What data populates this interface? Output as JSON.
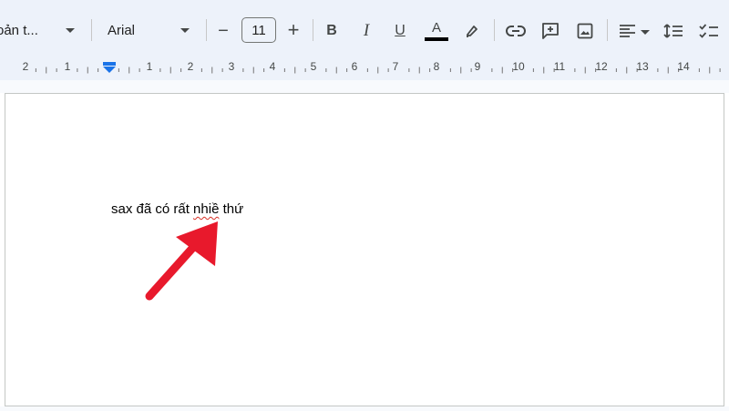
{
  "toolbar": {
    "style_dropdown": "oản t...",
    "font_family": "Arial",
    "font_size": "11",
    "decrease_font_label": "−",
    "increase_font_label": "+",
    "bold_label": "B",
    "italic_label": "I",
    "underline_label": "U",
    "text_color_label": "A",
    "text_color": "#000000"
  },
  "icons": {
    "style": "caret-down-icon",
    "highlight": "marker-pen-icon",
    "link": "link-icon",
    "comment": "add-comment-icon",
    "image": "image-icon",
    "align": "align-left-icon",
    "line_spacing": "line-spacing-icon",
    "checklist": "checklist-icon"
  },
  "ruler": {
    "labels": [
      "2",
      "1",
      "1",
      "2",
      "3",
      "4",
      "5",
      "6",
      "7",
      "8",
      "9",
      "10",
      "11",
      "12",
      "13",
      "14"
    ]
  },
  "document": {
    "text_before": "sax đã có rất ",
    "misspelled_word": "nhiề",
    "text_after": " thứ"
  },
  "colors": {
    "toolbar_bg": "#edf2fa",
    "annotation_arrow": "#e8192c",
    "spellcheck_underline": "#d93025",
    "indent_marker": "#1a73e8"
  }
}
